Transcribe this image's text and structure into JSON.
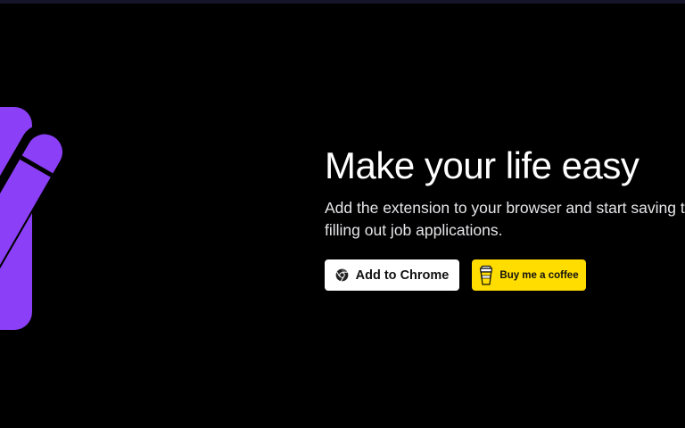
{
  "hero": {
    "headline": "Make your life easy",
    "subtitle": "Add the extension to your browser and start saving time filling out job applications."
  },
  "actions": {
    "add_to_chrome_label": "Add to Chrome",
    "buy_coffee_label": "Buy me a coffee"
  },
  "icons": {
    "logo": "pencil-icon",
    "chrome": "chrome-icon",
    "coffee": "coffee-cup-icon"
  },
  "colors": {
    "background": "#000000",
    "accent_purple": "#8b3ff7",
    "coffee_yellow": "#ffdd00",
    "chrome_button_bg": "#ffffff",
    "text_primary": "#ffffff"
  }
}
